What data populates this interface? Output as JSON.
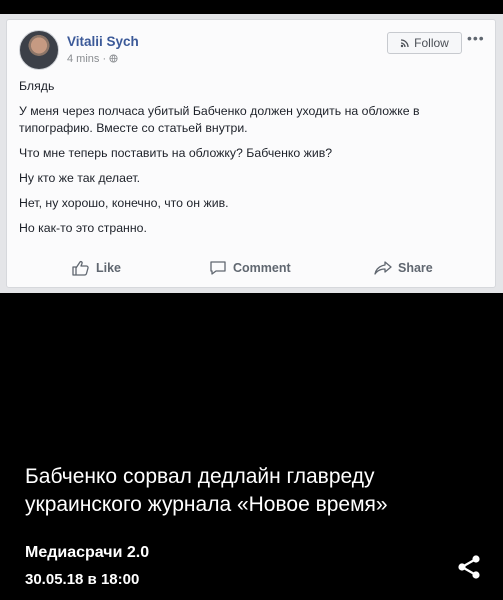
{
  "post": {
    "author": "Vitalii Sych",
    "meta": "4 mins · ",
    "follow_label": "Follow",
    "paragraphs": [
      "Блядь",
      "У меня через полчаса убитый Бабченко должен уходить на обложке в типографию. Вместе со статьей внутри.",
      "Что мне теперь поставить на обложку? Бабченко жив?",
      "Ну кто же так делает.",
      "Нет, ну хорошо, конечно, что он жив.",
      "Но как-то это странно."
    ],
    "actions": {
      "like": "Like",
      "comment": "Comment",
      "share": "Share"
    }
  },
  "caption": {
    "headline": "Бабченко сорвал дедлайн главреду украинского журнала «Новое время»",
    "source": "Медиасрачи 2.0",
    "date": "30.05.18 в 18:00"
  },
  "icons": {
    "follow": "rss-icon",
    "globe": "globe-icon",
    "more": "more-dots-icon",
    "like": "thumbs-up-icon",
    "comment": "speech-bubble-icon",
    "share": "share-arrow-icon",
    "page_share": "share-icon"
  },
  "colors": {
    "author": "#3b5998",
    "action": "#606770",
    "background": "#000000"
  }
}
